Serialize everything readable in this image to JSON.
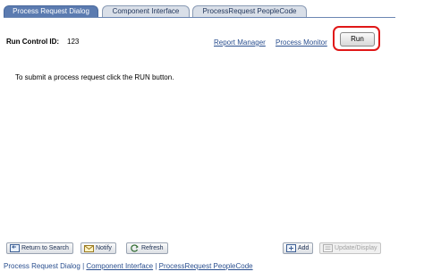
{
  "tabs": [
    {
      "label": "Process Request Dialog",
      "active": true
    },
    {
      "label": "Component Interface",
      "active": false
    },
    {
      "label": "ProcessRequest PeopleCode",
      "active": false
    }
  ],
  "run_control": {
    "label": "Run Control ID:",
    "value": "123"
  },
  "links": {
    "report_manager": "Report Manager",
    "process_monitor": "Process Monitor"
  },
  "run_button": "Run",
  "instruction": "To submit a process request click the RUN button.",
  "toolbar": {
    "return_to_search": "Return to Search",
    "notify": "Notify",
    "refresh": "Refresh",
    "add": "Add",
    "update_display": "Update/Display"
  },
  "bottom_links": {
    "item1": "Process Request Dialog",
    "item2": "Component Interface",
    "item3": "ProcessRequest PeopleCode",
    "separator": "|"
  },
  "colors": {
    "accent": "#5b7bb0",
    "link": "#2a4f8f",
    "highlight": "#e01818"
  }
}
